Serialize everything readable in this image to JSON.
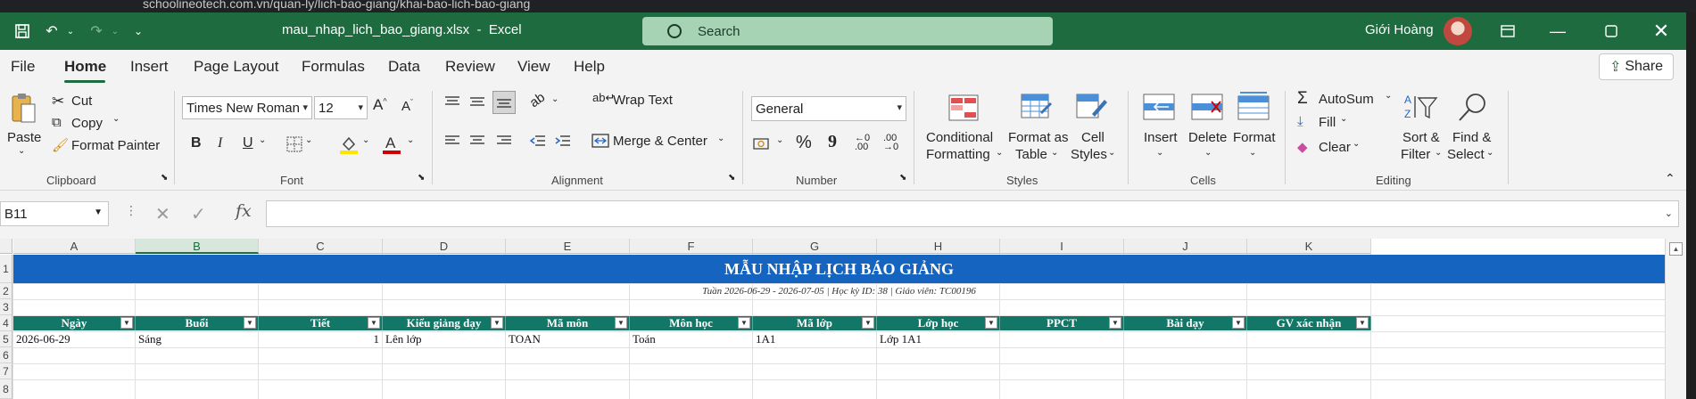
{
  "browser": {
    "url": "schoolineotech.com.vn/quan-ly/lich-bao-giang/khai-bao-lich-bao-giang"
  },
  "titlebar": {
    "filename": "mau_nhap_lich_bao_giang.xlsx",
    "app": "Excel",
    "separator": "-",
    "search_placeholder": "Search",
    "user_name": "Giới Hoàng"
  },
  "tabs": [
    "File",
    "Home",
    "Insert",
    "Page Layout",
    "Formulas",
    "Data",
    "Review",
    "View",
    "Help"
  ],
  "active_tab": "Home",
  "share_label": "Share",
  "ribbon": {
    "clipboard": {
      "paste": "Paste",
      "cut": "Cut",
      "copy": "Copy",
      "format_painter": "Format Painter",
      "label": "Clipboard"
    },
    "font": {
      "family": "Times New Roman",
      "size": "12",
      "bold": "B",
      "italic": "I",
      "underline": "U",
      "label": "Font"
    },
    "alignment": {
      "wrap_text": "Wrap Text",
      "merge_center": "Merge & Center",
      "label": "Alignment"
    },
    "number": {
      "format": "General",
      "percent": "%",
      "comma": "9",
      "label": "Number"
    },
    "styles": {
      "conditional_1": "Conditional",
      "conditional_2": "Formatting",
      "table_1": "Format as",
      "table_2": "Table",
      "cell_1": "Cell",
      "cell_2": "Styles",
      "label": "Styles"
    },
    "cells": {
      "insert": "Insert",
      "delete": "Delete",
      "format": "Format",
      "label": "Cells"
    },
    "editing": {
      "autosum": "AutoSum",
      "fill": "Fill",
      "clear": "Clear",
      "sort_1": "Sort &",
      "sort_2": "Filter",
      "find_1": "Find &",
      "find_2": "Select",
      "label": "Editing"
    }
  },
  "formula_bar": {
    "name_box": "B11",
    "fx": "fx",
    "value": ""
  },
  "grid": {
    "columns": [
      "A",
      "B",
      "C",
      "D",
      "E",
      "F",
      "G",
      "H",
      "I",
      "J",
      "K"
    ],
    "selected_column": "B",
    "rows": [
      "1",
      "2",
      "3",
      "4",
      "5",
      "6",
      "7",
      "8"
    ],
    "title": "MẪU NHẬP LỊCH BÁO GIẢNG",
    "subtitle": "Tuần 2026-06-29 - 2026-07-05 | Học kỳ ID: 38 | Giáo viên: TC00196",
    "headers": [
      "Ngày",
      "Buổi",
      "Tiết",
      "Kiểu giảng dạy",
      "Mã môn",
      "Môn học",
      "Mã lớp",
      "Lớp học",
      "PPCT",
      "Bài dạy",
      "GV xác nhận"
    ],
    "data_row": [
      "2026-06-29",
      "Sáng",
      "1",
      "Lên lớp",
      "TOAN",
      "Toán",
      "1A1",
      "Lớp 1A1",
      "",
      "",
      ""
    ]
  },
  "colors": {
    "title_bar": "#1e6b3f",
    "banner": "#1565c0",
    "header_fill": "#127766"
  }
}
